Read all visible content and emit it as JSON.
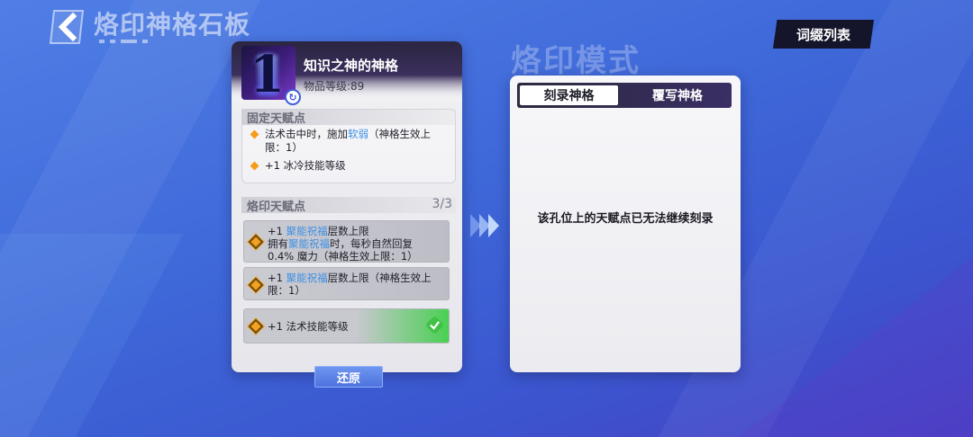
{
  "header": {
    "title": "烙印神格石板",
    "suffix_list_label": "词缀列表"
  },
  "item": {
    "icon_glyph": "1",
    "name": "知识之神的神格",
    "level": "物品等级:89"
  },
  "fixed_section": {
    "title": "固定天赋点",
    "rows": [
      {
        "before": "法术击中时，施加",
        "highlight": "软弱",
        "after": "（神格生效上限：1）"
      },
      {
        "before": "+1 冰冷技能等级",
        "highlight": "",
        "after": ""
      }
    ]
  },
  "imprint_section": {
    "title": "烙印天赋点",
    "count": "3/3",
    "rows": [
      {
        "line1_prefix": "+1 ",
        "line1_hl": "聚能祝福",
        "line1_suffix": "层数上限",
        "line2_prefix": "拥有",
        "line2_hl": "聚能祝福",
        "line2_suffix": "时，每秒自然回复",
        "line3": "0.4% 魔力（神格生效上限：1）"
      },
      {
        "line1_prefix": "+1 ",
        "line1_hl": "聚能祝福",
        "line1_suffix": "层数上限（神格生效上",
        "line2": "限：1）"
      },
      {
        "text": "+1 法术技能等级",
        "selected": true
      }
    ]
  },
  "restore_label": "还原",
  "mode": {
    "title": "烙印模式",
    "tabs": [
      "刻录神格",
      "覆写神格"
    ],
    "active_tab": 0,
    "message": "该孔位上的天赋点已无法继续刻录"
  },
  "icons": [
    "back-chevron-icon",
    "diamond-bullet-icon",
    "check-icon",
    "arrow-forward-icon",
    "refresh-badge-icon"
  ],
  "colors": {
    "accent_blue": "#3a8fe6",
    "bullet_orange": "#f59b1c",
    "check_green": "#40c246",
    "dark_panel": "#14142a"
  }
}
